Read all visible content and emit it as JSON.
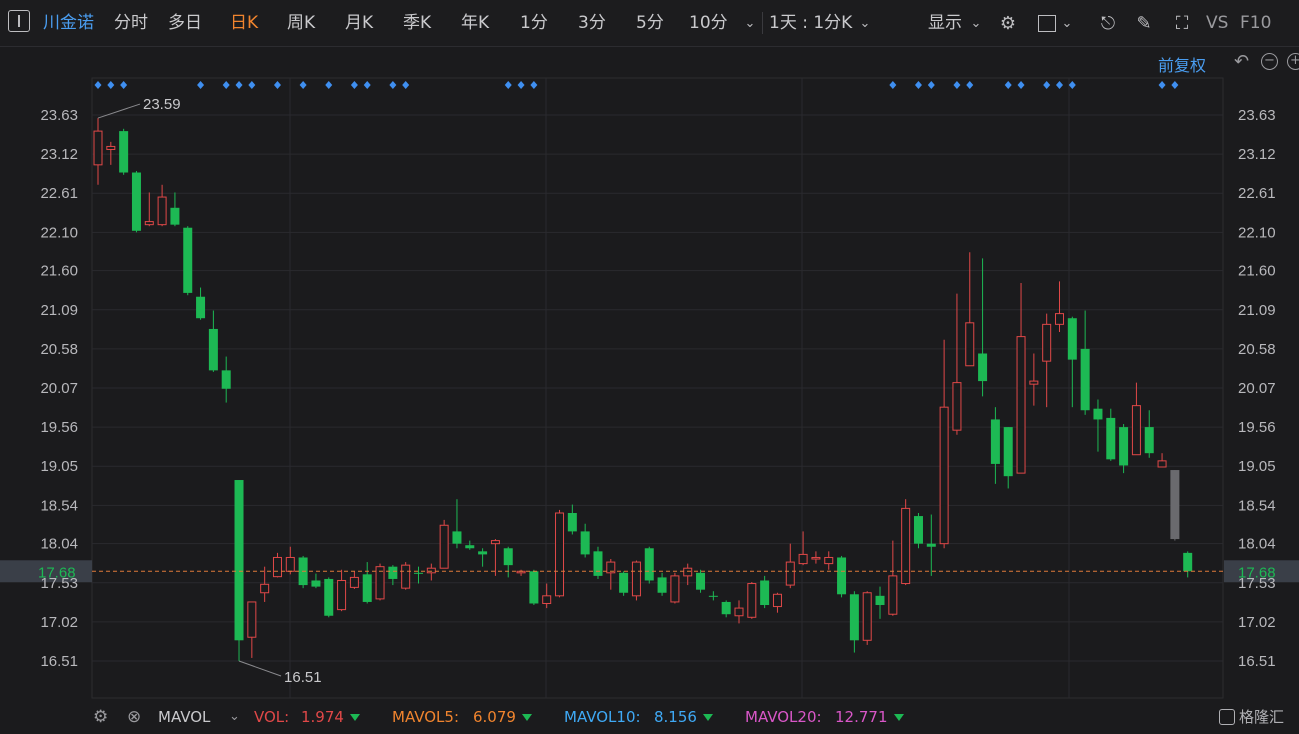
{
  "toolbar": {
    "stock_name": "川金诺",
    "periods": [
      "分时",
      "多日",
      "日K",
      "周K",
      "月K",
      "季K",
      "年K",
      "1分",
      "3分",
      "5分",
      "10分"
    ],
    "active_period": "日K",
    "custom_period": "1天 : 1分K",
    "display_label": "显示",
    "vs_label": "VS",
    "f10_label": "F10"
  },
  "chart": {
    "adjust_label": "前复权",
    "price_ticks": [
      "23.63",
      "23.12",
      "22.61",
      "22.10",
      "21.60",
      "21.09",
      "20.58",
      "20.07",
      "19.56",
      "19.05",
      "18.54",
      "18.04",
      "17.53",
      "17.02",
      "16.51"
    ],
    "current_price": "17.68",
    "high_annotation": "23.59",
    "low_annotation": "16.51"
  },
  "footer": {
    "indicator": "MAVOL",
    "vol_label": "VOL:",
    "vol_value": "1.974",
    "mavol5_label": "MAVOL5:",
    "mavol5_value": "6.079",
    "mavol10_label": "MAVOL10:",
    "mavol10_value": "8.156",
    "mavol20_label": "MAVOL20:",
    "mavol20_value": "12.771",
    "logo_text": "格隆汇"
  },
  "colors": {
    "up": "#e04848",
    "down": "#1db954",
    "accent": "#4a9df0",
    "active": "#f0842e",
    "marker": "#3f8ff0",
    "price_line": "#e07a3a"
  },
  "chart_data": {
    "type": "candlestick",
    "ylim": [
      16.25,
      23.9
    ],
    "candles": [
      {
        "o": 22.98,
        "c": 23.42,
        "h": 23.59,
        "l": 22.72
      },
      {
        "o": 23.18,
        "c": 23.22,
        "h": 23.28,
        "l": 22.98
      },
      {
        "o": 23.42,
        "c": 22.88,
        "h": 23.45,
        "l": 22.85
      },
      {
        "o": 22.88,
        "c": 22.12,
        "h": 22.9,
        "l": 22.1
      },
      {
        "o": 22.2,
        "c": 22.24,
        "h": 22.62,
        "l": 22.18
      },
      {
        "o": 22.2,
        "c": 22.56,
        "h": 22.72,
        "l": 22.18
      },
      {
        "o": 22.42,
        "c": 22.2,
        "h": 22.62,
        "l": 22.18
      },
      {
        "o": 22.16,
        "c": 21.31,
        "h": 22.18,
        "l": 21.28
      },
      {
        "o": 21.26,
        "c": 20.98,
        "h": 21.38,
        "l": 20.96
      },
      {
        "o": 20.84,
        "c": 20.3,
        "h": 21.08,
        "l": 20.28
      },
      {
        "o": 20.3,
        "c": 20.06,
        "h": 20.48,
        "l": 19.88
      },
      {
        "o": 18.87,
        "c": 16.78,
        "h": 18.87,
        "l": 16.51
      },
      {
        "o": 16.82,
        "c": 17.28,
        "h": 17.28,
        "l": 16.55
      },
      {
        "o": 17.4,
        "c": 17.51,
        "h": 17.74,
        "l": 17.28
      },
      {
        "o": 17.61,
        "c": 17.86,
        "h": 17.92,
        "l": 17.6
      },
      {
        "o": 17.68,
        "c": 17.86,
        "h": 18.0,
        "l": 17.64
      },
      {
        "o": 17.86,
        "c": 17.5,
        "h": 17.88,
        "l": 17.46
      },
      {
        "o": 17.56,
        "c": 17.48,
        "h": 17.65,
        "l": 17.46
      },
      {
        "o": 17.58,
        "c": 17.1,
        "h": 17.6,
        "l": 17.08
      },
      {
        "o": 17.18,
        "c": 17.56,
        "h": 17.7,
        "l": 17.16
      },
      {
        "o": 17.47,
        "c": 17.6,
        "h": 17.68,
        "l": 17.45
      },
      {
        "o": 17.64,
        "c": 17.28,
        "h": 17.8,
        "l": 17.26
      },
      {
        "o": 17.32,
        "c": 17.74,
        "h": 17.78,
        "l": 17.3
      },
      {
        "o": 17.74,
        "c": 17.58,
        "h": 17.76,
        "l": 17.5
      },
      {
        "o": 17.46,
        "c": 17.76,
        "h": 17.8,
        "l": 17.44
      },
      {
        "o": 17.66,
        "c": 17.66,
        "h": 17.74,
        "l": 17.52
      },
      {
        "o": 17.66,
        "c": 17.72,
        "h": 17.78,
        "l": 17.56
      },
      {
        "o": 17.72,
        "c": 18.28,
        "h": 18.35,
        "l": 17.72
      },
      {
        "o": 18.2,
        "c": 18.04,
        "h": 18.62,
        "l": 17.98
      },
      {
        "o": 18.02,
        "c": 17.98,
        "h": 18.08,
        "l": 17.96
      },
      {
        "o": 17.94,
        "c": 17.9,
        "h": 17.98,
        "l": 17.74
      },
      {
        "o": 18.04,
        "c": 18.08,
        "h": 18.1,
        "l": 17.62
      },
      {
        "o": 17.98,
        "c": 17.76,
        "h": 18.0,
        "l": 17.6
      },
      {
        "o": 17.66,
        "c": 17.68,
        "h": 17.7,
        "l": 17.62
      },
      {
        "o": 17.68,
        "c": 17.26,
        "h": 17.7,
        "l": 17.24
      },
      {
        "o": 17.26,
        "c": 17.36,
        "h": 17.52,
        "l": 17.2
      },
      {
        "o": 17.36,
        "c": 18.44,
        "h": 18.48,
        "l": 17.34
      },
      {
        "o": 18.44,
        "c": 18.2,
        "h": 18.55,
        "l": 18.16
      },
      {
        "o": 18.2,
        "c": 17.9,
        "h": 18.3,
        "l": 17.86
      },
      {
        "o": 17.94,
        "c": 17.62,
        "h": 18.0,
        "l": 17.58
      },
      {
        "o": 17.66,
        "c": 17.8,
        "h": 17.84,
        "l": 17.44
      },
      {
        "o": 17.66,
        "c": 17.4,
        "h": 17.68,
        "l": 17.36
      },
      {
        "o": 17.36,
        "c": 17.8,
        "h": 17.82,
        "l": 17.3
      },
      {
        "o": 17.98,
        "c": 17.56,
        "h": 18.0,
        "l": 17.52
      },
      {
        "o": 17.6,
        "c": 17.4,
        "h": 17.66,
        "l": 17.36
      },
      {
        "o": 17.28,
        "c": 17.62,
        "h": 17.66,
        "l": 17.26
      },
      {
        "o": 17.62,
        "c": 17.72,
        "h": 17.78,
        "l": 17.5
      },
      {
        "o": 17.66,
        "c": 17.44,
        "h": 17.7,
        "l": 17.4
      },
      {
        "o": 17.36,
        "c": 17.36,
        "h": 17.42,
        "l": 17.3
      },
      {
        "o": 17.28,
        "c": 17.12,
        "h": 17.3,
        "l": 17.08
      },
      {
        "o": 17.1,
        "c": 17.2,
        "h": 17.3,
        "l": 17.0
      },
      {
        "o": 17.08,
        "c": 17.52,
        "h": 17.54,
        "l": 17.06
      },
      {
        "o": 17.56,
        "c": 17.24,
        "h": 17.62,
        "l": 17.2
      },
      {
        "o": 17.22,
        "c": 17.38,
        "h": 17.4,
        "l": 17.14
      },
      {
        "o": 17.5,
        "c": 17.8,
        "h": 18.04,
        "l": 17.46
      },
      {
        "o": 17.78,
        "c": 17.9,
        "h": 18.2,
        "l": 17.76
      },
      {
        "o": 17.84,
        "c": 17.86,
        "h": 17.94,
        "l": 17.78
      },
      {
        "o": 17.78,
        "c": 17.86,
        "h": 17.94,
        "l": 17.7
      },
      {
        "o": 17.86,
        "c": 17.38,
        "h": 17.88,
        "l": 17.34
      },
      {
        "o": 17.38,
        "c": 16.78,
        "h": 17.42,
        "l": 16.62
      },
      {
        "o": 16.78,
        "c": 17.4,
        "h": 17.42,
        "l": 16.72
      },
      {
        "o": 17.36,
        "c": 17.24,
        "h": 17.48,
        "l": 17.06
      },
      {
        "o": 17.12,
        "c": 17.62,
        "h": 18.08,
        "l": 17.1
      },
      {
        "o": 17.52,
        "c": 18.5,
        "h": 18.62,
        "l": 17.5
      },
      {
        "o": 18.4,
        "c": 18.04,
        "h": 18.44,
        "l": 17.98
      },
      {
        "o": 18.04,
        "c": 18.0,
        "h": 18.42,
        "l": 17.62
      },
      {
        "o": 18.04,
        "c": 19.82,
        "h": 20.7,
        "l": 17.98
      },
      {
        "o": 19.52,
        "c": 20.14,
        "h": 21.3,
        "l": 19.46
      },
      {
        "o": 20.36,
        "c": 20.92,
        "h": 21.84,
        "l": 20.36
      },
      {
        "o": 20.52,
        "c": 20.16,
        "h": 21.76,
        "l": 19.96
      },
      {
        "o": 19.66,
        "c": 19.08,
        "h": 19.82,
        "l": 18.82
      },
      {
        "o": 19.56,
        "c": 18.92,
        "h": 19.56,
        "l": 18.76
      },
      {
        "o": 18.96,
        "c": 20.74,
        "h": 21.44,
        "l": 18.96
      },
      {
        "o": 20.12,
        "c": 20.16,
        "h": 20.52,
        "l": 19.84
      },
      {
        "o": 20.42,
        "c": 20.9,
        "h": 21.04,
        "l": 19.82
      },
      {
        "o": 20.9,
        "c": 21.04,
        "h": 21.46,
        "l": 20.8
      },
      {
        "o": 20.98,
        "c": 20.44,
        "h": 21.0,
        "l": 19.82
      },
      {
        "o": 20.58,
        "c": 19.78,
        "h": 21.08,
        "l": 19.72
      },
      {
        "o": 19.8,
        "c": 19.66,
        "h": 19.92,
        "l": 19.24
      },
      {
        "o": 19.68,
        "c": 19.14,
        "h": 19.8,
        "l": 19.12
      },
      {
        "o": 19.56,
        "c": 19.06,
        "h": 19.6,
        "l": 18.96
      },
      {
        "o": 19.2,
        "c": 19.84,
        "h": 20.14,
        "l": 19.2
      },
      {
        "o": 19.56,
        "c": 19.22,
        "h": 19.78,
        "l": 19.16
      },
      {
        "o": 19.04,
        "c": 19.12,
        "h": 19.22,
        "l": 19.04
      },
      {
        "o": 18.1,
        "c": 19.0,
        "h": 19.0,
        "l": 18.08
      },
      {
        "o": 17.92,
        "c": 17.68,
        "h": 17.94,
        "l": 17.6
      }
    ]
  }
}
